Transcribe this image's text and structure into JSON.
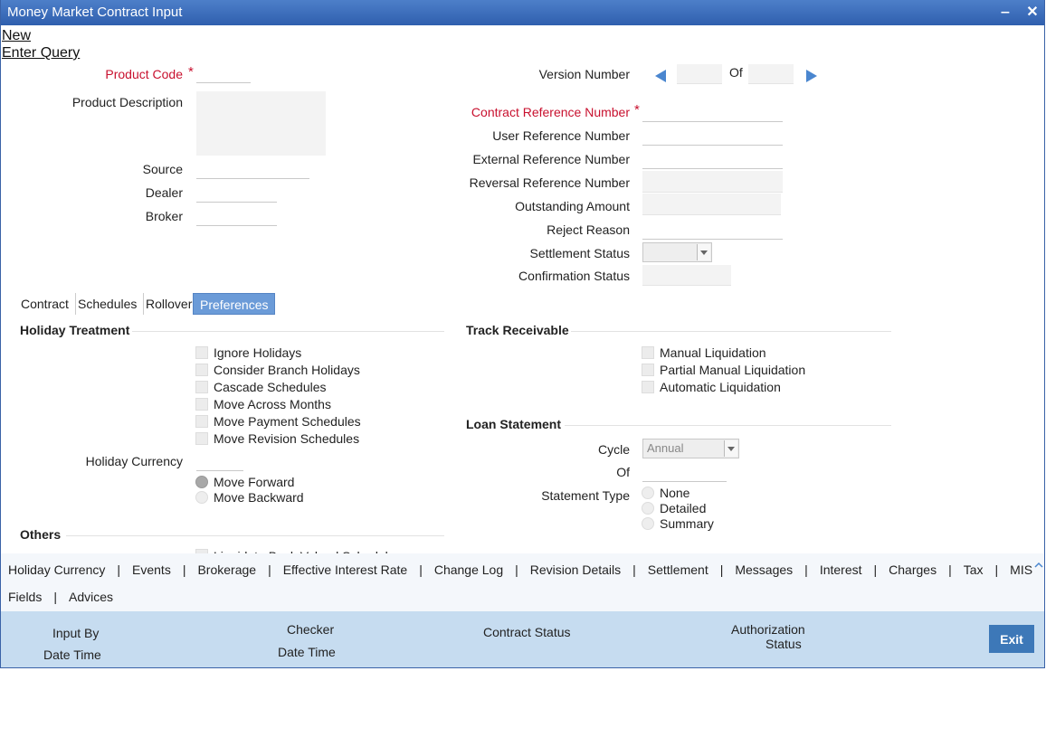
{
  "window": {
    "title": "Money Market Contract Input"
  },
  "actions": {
    "new": "New",
    "enter_query": "Enter Query"
  },
  "left_fields": {
    "product_code": "Product Code",
    "product_description": "Product Description",
    "source": "Source",
    "dealer": "Dealer",
    "broker": "Broker"
  },
  "right_fields": {
    "version_number": "Version Number",
    "of": "Of",
    "contract_reference_number": "Contract Reference Number",
    "user_reference_number": "User Reference Number",
    "external_reference_number": "External Reference Number",
    "reversal_reference_number": "Reversal Reference Number",
    "outstanding_amount": "Outstanding Amount",
    "reject_reason": "Reject Reason",
    "settlement_status": "Settlement Status",
    "confirmation_status": "Confirmation Status"
  },
  "required_marker": "*",
  "tabs": [
    "Contract",
    "Schedules",
    "Rollover",
    "Preferences"
  ],
  "holiday_treatment": {
    "title": "Holiday Treatment",
    "options": [
      "Ignore Holidays",
      "Consider Branch Holidays",
      "Cascade Schedules",
      "Move Across Months",
      "Move Payment Schedules",
      "Move Revision Schedules"
    ],
    "holiday_currency": "Holiday Currency",
    "move_forward": "Move Forward",
    "move_backward": "Move Backward"
  },
  "others": {
    "title": "Others",
    "partial_text": "Liquidate Back Valued Schedules"
  },
  "track_receivable": {
    "title": "Track Receivable",
    "options": [
      "Manual Liquidation",
      "Partial Manual Liquidation",
      "Automatic Liquidation"
    ]
  },
  "loan_statement": {
    "title": "Loan Statement",
    "cycle_label": "Cycle",
    "cycle_value": "Annual",
    "of_label": "Of",
    "statement_type_label": "Statement Type",
    "statement_types": [
      "None",
      "Detailed",
      "Summary"
    ]
  },
  "subnav": {
    "row1": [
      "Holiday Currency",
      "Events",
      "Brokerage",
      "Effective Interest Rate",
      "Change Log",
      "Revision Details",
      "Settlement",
      "Messages",
      "Interest",
      "Charges",
      "Tax",
      "MIS"
    ],
    "row2": [
      "Fields",
      "Advices"
    ],
    "trailing_pipe": "|",
    "pipe": "|"
  },
  "footer": {
    "input_by": "Input By",
    "date_time_1": "Date Time",
    "checker": "Checker",
    "date_time_2": "Date Time",
    "contract_status": "Contract Status",
    "authorization": "Authorization",
    "status": "Status",
    "exit": "Exit"
  },
  "colors": {
    "title_bar": "#2f5fae",
    "active_tab": "#6b9bd8",
    "required": "#c8102e",
    "footer": "#c6dcf0",
    "exit_button": "#3d78b8"
  }
}
